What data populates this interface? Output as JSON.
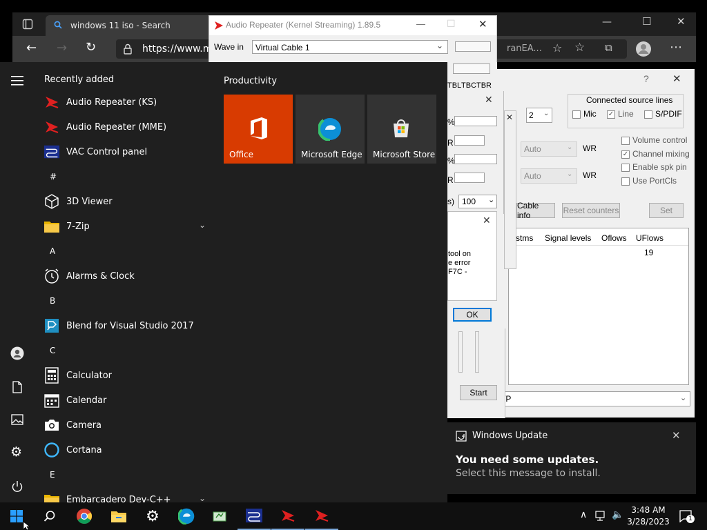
{
  "browser": {
    "tab_title": "windows 11 iso - Search",
    "url": "https://www.mi",
    "partial_tab_text": "ranEA..."
  },
  "audio_repeater": {
    "title": "Audio Repeater (Kernel Streaming) 1.89.5",
    "wave_in_label": "Wave in",
    "wave_in_value": "Virtual Cable 1",
    "col_headers": [
      "TBL",
      "TBC",
      "TBR"
    ],
    "buffer_value": "100",
    "start_label": "Start"
  },
  "vac_panel": {
    "connected_title": "Connected source lines",
    "lines": [
      {
        "label": "Mic",
        "checked": false
      },
      {
        "label": "Line",
        "checked": true
      },
      {
        "label": "S/PDIF",
        "checked": false
      }
    ],
    "count_value": "2",
    "auto1": "Auto",
    "auto2": "Auto",
    "wr1": "WR",
    "wr2": "WR",
    "options": [
      {
        "label": "Volume control",
        "checked": false
      },
      {
        "label": "Channel mixing",
        "checked": true
      },
      {
        "label": "Enable spk pin",
        "checked": false
      },
      {
        "label": "Use PortCls",
        "checked": false
      }
    ],
    "cable_info": "Cable info",
    "reset_counters": "Reset counters",
    "set": "Set",
    "table_headers": [
      "stms",
      "Signal levels",
      "Oflows",
      "UFlows"
    ],
    "uflows_value": "19",
    "bottom_select": "/P"
  },
  "error_dialog": {
    "line1": "tool on",
    "line2": "e error",
    "line3": "F7C -",
    "ok": "OK"
  },
  "mid_dialog": {
    "row_labels": [
      "%",
      "R",
      "%",
      "R"
    ],
    "suffix": "s)"
  },
  "start_menu": {
    "recently_added": "Recently added",
    "productivity": "Productivity",
    "apps": [
      {
        "type": "app",
        "label": "Audio Repeater (KS)",
        "icon": "audio-repeater-icon"
      },
      {
        "type": "app",
        "label": "Audio Repeater (MME)",
        "icon": "audio-repeater-icon"
      },
      {
        "type": "app",
        "label": "VAC Control panel",
        "icon": "vac-icon"
      },
      {
        "type": "letter",
        "label": "#"
      },
      {
        "type": "app",
        "label": "3D Viewer",
        "icon": "cube-icon"
      },
      {
        "type": "app",
        "label": "7-Zip",
        "icon": "folder-icon",
        "expand": true
      },
      {
        "type": "letter",
        "label": "A"
      },
      {
        "type": "app",
        "label": "Alarms & Clock",
        "icon": "clock-icon"
      },
      {
        "type": "letter",
        "label": "B"
      },
      {
        "type": "app",
        "label": "Blend for Visual Studio 2017",
        "icon": "blend-icon"
      },
      {
        "type": "letter",
        "label": "C"
      },
      {
        "type": "app",
        "label": "Calculator",
        "icon": "calculator-icon"
      },
      {
        "type": "app",
        "label": "Calendar",
        "icon": "calendar-icon"
      },
      {
        "type": "app",
        "label": "Camera",
        "icon": "camera-icon"
      },
      {
        "type": "app",
        "label": "Cortana",
        "icon": "cortana-icon"
      },
      {
        "type": "letter",
        "label": "E"
      },
      {
        "type": "app",
        "label": "Embarcadero Dev-C++",
        "icon": "folder-icon",
        "expand": true
      }
    ],
    "tiles": [
      {
        "label": "Office",
        "color": "#d83b01",
        "icon": "office-icon"
      },
      {
        "label": "Microsoft Edge",
        "color": "#333333",
        "icon": "edge-icon"
      },
      {
        "label": "Microsoft Store",
        "color": "#333333",
        "icon": "store-icon"
      }
    ]
  },
  "notification": {
    "app_name": "Windows Update",
    "title": "You need some updates.",
    "body": "Select this message to install."
  },
  "taskbar": {
    "time": "3:48 AM",
    "date": "3/28/2023",
    "notif_count": "1"
  },
  "colors": {
    "office": "#d83b01",
    "accent_blue": "#0078d7",
    "dark_bg": "#1f1f1f"
  }
}
